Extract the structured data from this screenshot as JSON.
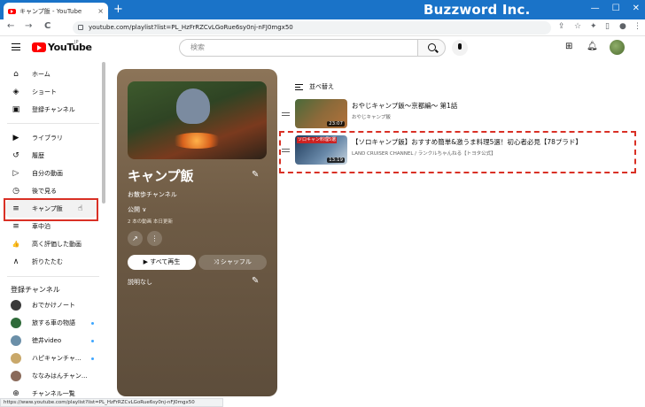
{
  "browser": {
    "tab_title": "キャンプ飯 - YouTube",
    "tab_close": "×",
    "new_tab": "+",
    "brand": "Buzzword Inc.",
    "url": "youtube.com/playlist?list=PL_HzFrRZCvLGoRue6sy0nj-nFJ0mgx50",
    "back": "←",
    "forward": "→",
    "reload": "C",
    "status_url": "https://www.youtube.com/playlist?list=PL_HzFrRZCvLGoRue6sy0nj-nFJ0mgx50"
  },
  "header": {
    "logo_text": "YouTube",
    "logo_region": "JP",
    "search_placeholder": "検索"
  },
  "sidebar": {
    "items": [
      {
        "label": "ホーム",
        "icon": "home-icon",
        "glyph": "⌂"
      },
      {
        "label": "ショート",
        "icon": "shorts-icon",
        "glyph": "◈"
      },
      {
        "label": "登録チャンネル",
        "icon": "subscriptions-icon",
        "glyph": "▣"
      },
      {
        "label": "ライブラリ",
        "icon": "library-icon",
        "glyph": "▶"
      },
      {
        "label": "履歴",
        "icon": "history-icon",
        "glyph": "↺"
      },
      {
        "label": "自分の動画",
        "icon": "your-videos-icon",
        "glyph": "▷"
      },
      {
        "label": "後で見る",
        "icon": "watch-later-icon",
        "glyph": "◷"
      },
      {
        "label": "キャンプ飯",
        "icon": "playlist-icon",
        "glyph": "≡"
      },
      {
        "label": "車中泊",
        "icon": "playlist-icon",
        "glyph": "≡"
      },
      {
        "label": "高く評価した動画",
        "icon": "like-icon",
        "glyph": "👍"
      },
      {
        "label": "折りたたむ",
        "icon": "chevron-up-icon",
        "glyph": "∧"
      }
    ],
    "subscriptions_heading": "登録チャンネル",
    "subscriptions": [
      {
        "label": "おでかけノート",
        "color": "#3a3a3a",
        "new": false
      },
      {
        "label": "旅する車の物語",
        "color": "#2f6b3a",
        "new": true
      },
      {
        "label": "徳井video",
        "color": "#6b8fa8",
        "new": true
      },
      {
        "label": "ハピキャンチャ...",
        "color": "#c9a86a",
        "new": true
      },
      {
        "label": "ななみはんチャン...",
        "color": "#8a6a5a",
        "new": false
      }
    ],
    "all_channels": "チャンネル一覧",
    "all_channels_glyph": "⊕"
  },
  "playlist": {
    "title": "キャンプ飯",
    "owner": "お散歩チャンネル",
    "visibility": "公開",
    "meta": "2 本の動画  本日更新",
    "play_all": "すべて再生",
    "shuffle": "シャッフル",
    "description": "説明なし"
  },
  "videos": {
    "sort_label": "並べ替え",
    "list": [
      {
        "title": "おやじキャンプ飯〜京都編〜 第1話",
        "channel": "おやじキャンプ飯",
        "duration": "23:07",
        "thumb_a": "#4a6a3a",
        "thumb_b": "#b4723a"
      },
      {
        "title": "【ソロキャンプ飯】おすすめ簡単&激うま料理5選！初心者必見【78プラド】",
        "channel": "LAND CRUISER CHANNEL / ランクルちゃんねる【トヨタ公式】",
        "duration": "13:19",
        "thumb_a": "#1e3a5a",
        "thumb_b": "#6a8aaa",
        "overlay": "ソロキャン料理5選"
      }
    ]
  }
}
